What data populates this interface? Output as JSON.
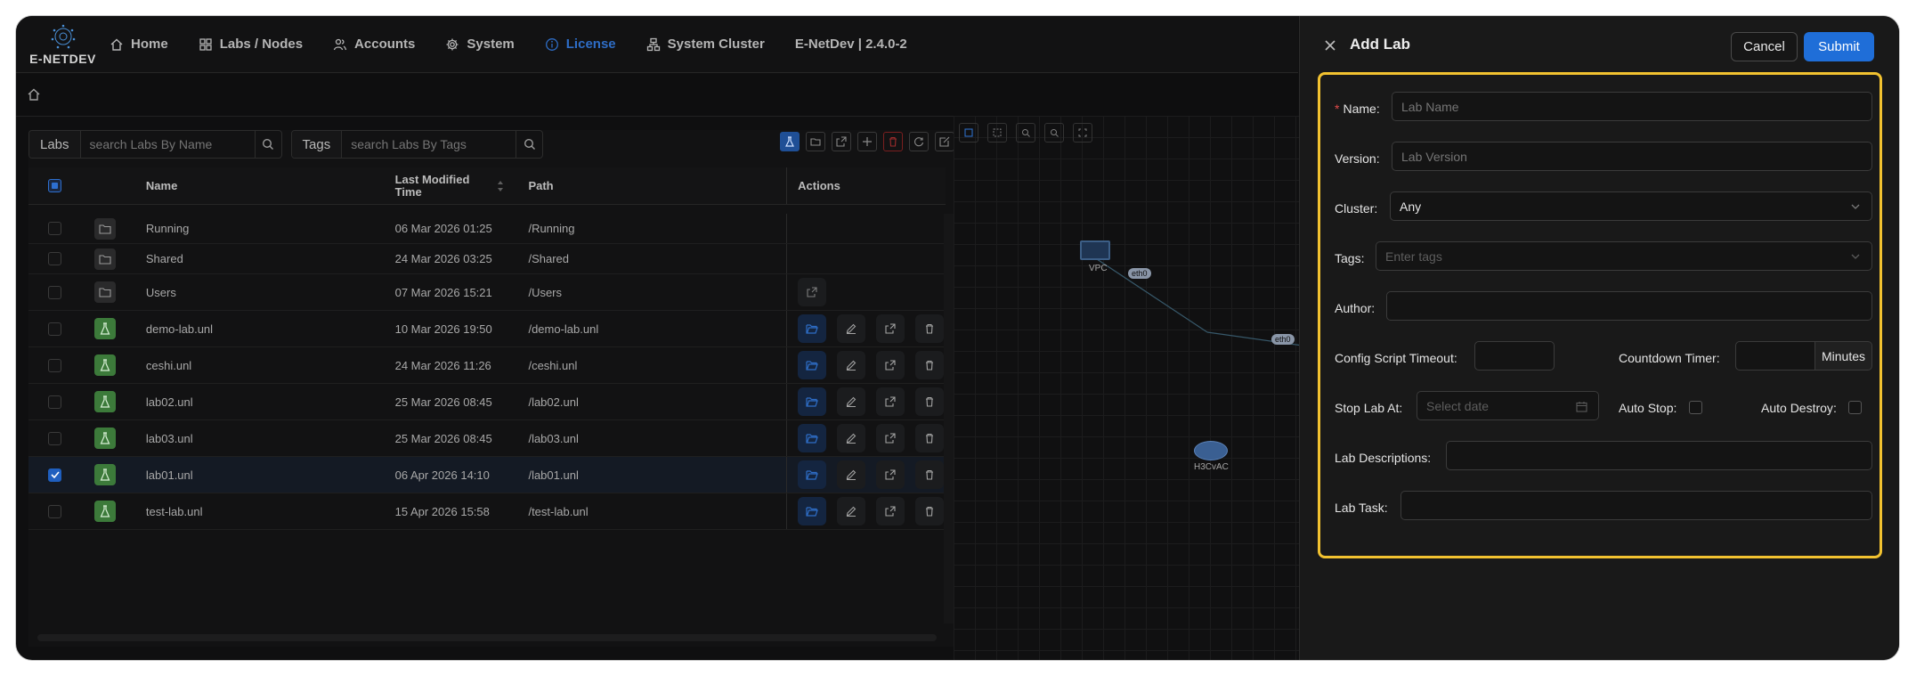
{
  "app": {
    "logo_text": "E-NETDEV",
    "nav": [
      {
        "label": "Home",
        "icon": "home-icon"
      },
      {
        "label": "Labs / Nodes",
        "icon": "grid-icon"
      },
      {
        "label": "Accounts",
        "icon": "users-icon"
      },
      {
        "label": "System",
        "icon": "gear-icon"
      },
      {
        "label": "License",
        "icon": "info-icon",
        "active": true
      },
      {
        "label": "System Cluster",
        "icon": "cluster-icon"
      }
    ],
    "version": "E-NetDev | 2.4.0-2",
    "accent_color": "#2e6dc6"
  },
  "search": {
    "labs_label": "Labs",
    "labs_placeholder": "search Labs By Name",
    "tags_label": "Tags",
    "tags_placeholder": "search Labs By Tags"
  },
  "table": {
    "columns": {
      "name": "Name",
      "time": "Last Modified Time",
      "path": "Path",
      "actions": "Actions"
    },
    "rows": [
      {
        "type": "folder",
        "name": "Running",
        "time": "06 Mar 2026 01:25",
        "path": "/Running",
        "checked": false
      },
      {
        "type": "folder",
        "name": "Shared",
        "time": "24 Mar 2026 03:25",
        "path": "/Shared",
        "checked": false
      },
      {
        "type": "folder",
        "name": "Users",
        "time": "07 Mar 2026 15:21",
        "path": "/Users",
        "checked": false
      },
      {
        "type": "lab",
        "name": "demo-lab.unl",
        "time": "10 Mar 2026 19:50",
        "path": "/demo-lab.unl",
        "checked": false
      },
      {
        "type": "lab",
        "name": "ceshi.unl",
        "time": "24 Mar 2026 11:26",
        "path": "/ceshi.unl",
        "checked": false
      },
      {
        "type": "lab",
        "name": "lab02.unl",
        "time": "25 Mar 2026 08:45",
        "path": "/lab02.unl",
        "checked": false
      },
      {
        "type": "lab",
        "name": "lab03.unl",
        "time": "25 Mar 2026 08:45",
        "path": "/lab03.unl",
        "checked": false
      },
      {
        "type": "lab",
        "name": "lab01.unl",
        "time": "06 Apr 2026 14:10",
        "path": "/lab01.unl",
        "checked": true
      },
      {
        "type": "lab",
        "name": "test-lab.unl",
        "time": "15 Apr 2026 15:58",
        "path": "/test-lab.unl",
        "checked": false
      }
    ]
  },
  "canvas": {
    "nodes": [
      {
        "label": "VPC"
      },
      {
        "label": "H3CvAC"
      }
    ],
    "interfaces": [
      "eth0",
      "eth0"
    ]
  },
  "drawer": {
    "title": "Add Lab",
    "cancel_label": "Cancel",
    "submit_label": "Submit",
    "highlight_color": "#f2c230",
    "fields": {
      "name_label": "Name",
      "name_placeholder": "Lab Name",
      "version_label": "Version",
      "version_placeholder": "Lab Version",
      "cluster_label": "Cluster",
      "cluster_value": "Any",
      "tags_label": "Tags",
      "tags_placeholder": "Enter tags",
      "author_label": "Author",
      "config_timeout_label": "Config Script Timeout",
      "countdown_label": "Countdown Timer",
      "countdown_unit": "Minutes",
      "stop_at_label": "Stop Lab At",
      "stop_at_placeholder": "Select date",
      "auto_stop_label": "Auto Stop",
      "auto_destroy_label": "Auto Destroy",
      "descriptions_label": "Lab Descriptions",
      "task_label": "Lab Task"
    }
  }
}
